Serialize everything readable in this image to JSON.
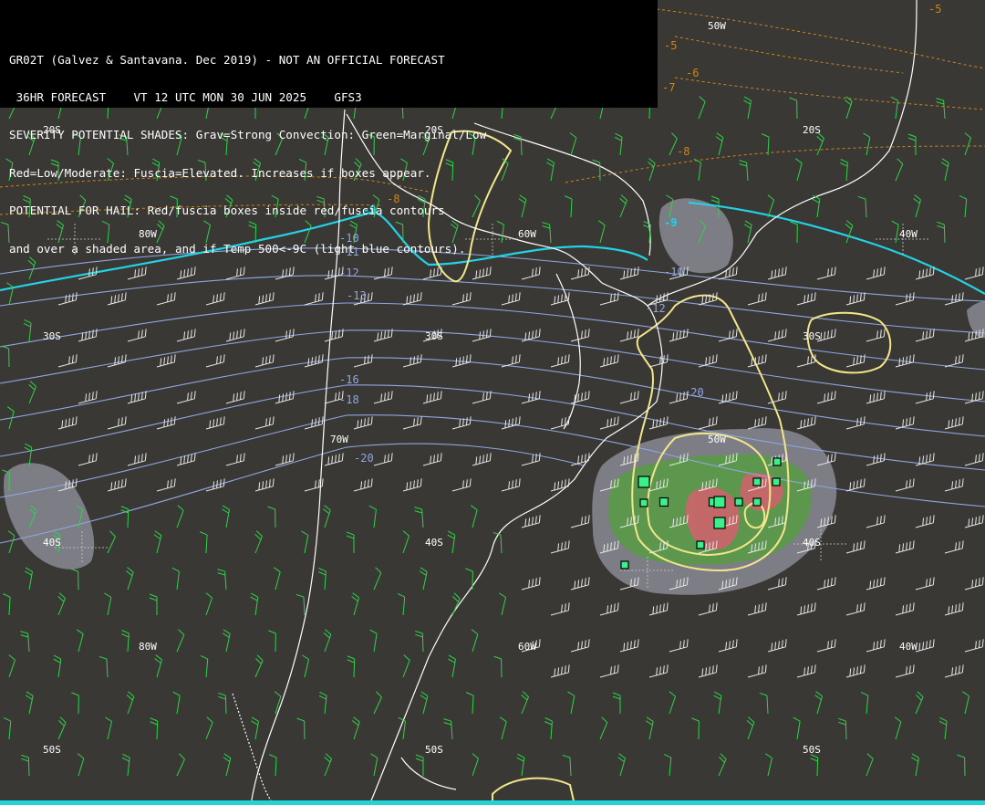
{
  "header": {
    "lines": [
      "GR02T (Galvez & Santavana. Dec 2019) - NOT AN OFFICIAL FORECAST",
      " 36HR FORECAST    VT 12 UTC MON 30 JUN 2025    GFS3",
      "SEVERITY POTENTIAL SHADES: Grav=Strong Convection: Green=Marginal/Low",
      "Red=Low/Moderate: Fuscia=Elevated. Increases if boxes appear.",
      "POTENTIAL FOR HAIL: Red/fuscia boxes inside red/fuscia contours",
      "and over a shaded area, and if Temp 500<-9C (light blue contours)."
    ]
  },
  "grid_labels": {
    "lat_20s_left": "20S",
    "lat_20s_mid": "20S",
    "lat_20s_right": "20S",
    "lat_30s_left": "30S",
    "lat_30s_mid": "30S",
    "lat_30s_right": "30S",
    "lat_40s_left": "40S",
    "lat_40s_mid": "40S",
    "lat_40s_right": "40S",
    "lat_50s_left": "50S",
    "lat_50s_mid": "50S",
    "lat_50s_right": "50S",
    "lon_80w_top": "80W",
    "lon_60w_top": "60W",
    "lon_50w_top": "50W",
    "lon_40w_top": "40W",
    "lon_70w_mid": "70W",
    "lon_50w_mid": "50W",
    "lon_80w_bottom": "80W",
    "lon_60w_bottom": "60W",
    "lon_40w_bottom": "40W"
  },
  "temp_labels": {
    "t500_m9_west": "-9",
    "t500_m9_east": "-9",
    "blue_m10_a": "-10",
    "blue_m11": "-11",
    "blue_m12_a": "-12",
    "blue_m10_b": "-10",
    "blue_m12_b": "-12",
    "blue_m13": "-13",
    "blue_m16": "-16",
    "blue_m18": "-18",
    "blue_m20_a": "-20",
    "blue_m20_b": "-20",
    "orange_m5_a": "-5",
    "orange_m5_b": "-5",
    "orange_m6": "-6",
    "orange_m7_a": "-7",
    "orange_m7_b": "-7",
    "orange_m8_a": "-8",
    "orange_m8_b": "-8"
  },
  "colors": {
    "background": "#3a3835",
    "coast": "#ffffff",
    "t500_minus9": "#22d3e6",
    "blue_contour": "#8fa6e0",
    "orange_contour": "#c8861e",
    "yellow_contour": "#f2e68a",
    "gray_shade": "#8a8a94",
    "green_shade": "#5a9a48",
    "red_shade": "#c8666a",
    "hail_box": "#3af08a",
    "barb_green": "#2fd24a",
    "barb_white": "#e8e8e8"
  },
  "icons": [
    "wind-barb",
    "hail-box"
  ]
}
